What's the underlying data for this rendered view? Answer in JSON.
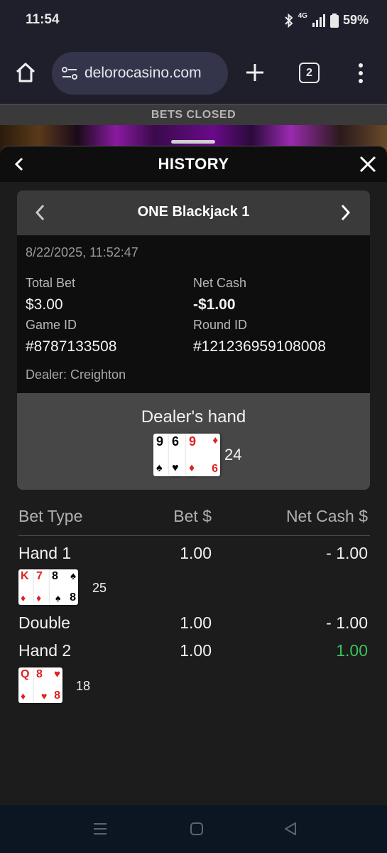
{
  "status_bar": {
    "time": "11:54",
    "network": "4G",
    "battery": "59%"
  },
  "browser": {
    "url": "delorocasino.com",
    "tab_count": "2"
  },
  "game": {
    "banner": "BETS CLOSED"
  },
  "history": {
    "title": "HISTORY",
    "game_name": "ONE Blackjack 1",
    "datetime": "8/22/2025, 11:52:47",
    "total_bet_label": "Total Bet",
    "total_bet": "$3.00",
    "net_cash_label": "Net Cash",
    "net_cash": "-$1.00",
    "game_id_label": "Game ID",
    "game_id": "#8787133508",
    "round_id_label": "Round ID",
    "round_id": "#121236959108008",
    "dealer": "Dealer: Creighton",
    "dealer_hand_label": "Dealer's hand",
    "dealer_cards": [
      {
        "rank": "9",
        "suit": "♠",
        "color": "#000000"
      },
      {
        "rank": "6",
        "suit": "♥",
        "color": "#000000"
      },
      {
        "rank": "9",
        "suit": "♦",
        "color": "#e02020"
      },
      {
        "rank": "6",
        "suit": "♦",
        "color": "#e02020"
      }
    ],
    "dealer_total": "24",
    "table": {
      "headers": [
        "Bet Type",
        "Bet $",
        "Net Cash $"
      ],
      "rows": [
        {
          "type": "Hand 1",
          "bet": "1.00",
          "net": "- 1.00",
          "total": "25",
          "cards": [
            {
              "rank": "K",
              "suit": "♦"
            },
            {
              "rank": "7",
              "suit": "♦"
            },
            {
              "rank": "8",
              "suit": "♠"
            }
          ]
        },
        {
          "type": "Double",
          "bet": "1.00",
          "net": "- 1.00"
        },
        {
          "type": "Hand 2",
          "bet": "1.00",
          "net": "1.00",
          "net_color": "#3cc35a",
          "total": "18",
          "cards": [
            {
              "rank": "Q",
              "suit": "♦"
            },
            {
              "rank": "8",
              "suit": "♥"
            }
          ]
        }
      ]
    }
  },
  "icons": [
    "home-icon",
    "site-settings-icon",
    "plus-icon",
    "tabs-icon",
    "more-vert-icon",
    "chevron-left-icon",
    "close-icon",
    "chevron-right-icon",
    "recents-icon",
    "home-nav-icon",
    "back-nav-icon"
  ]
}
